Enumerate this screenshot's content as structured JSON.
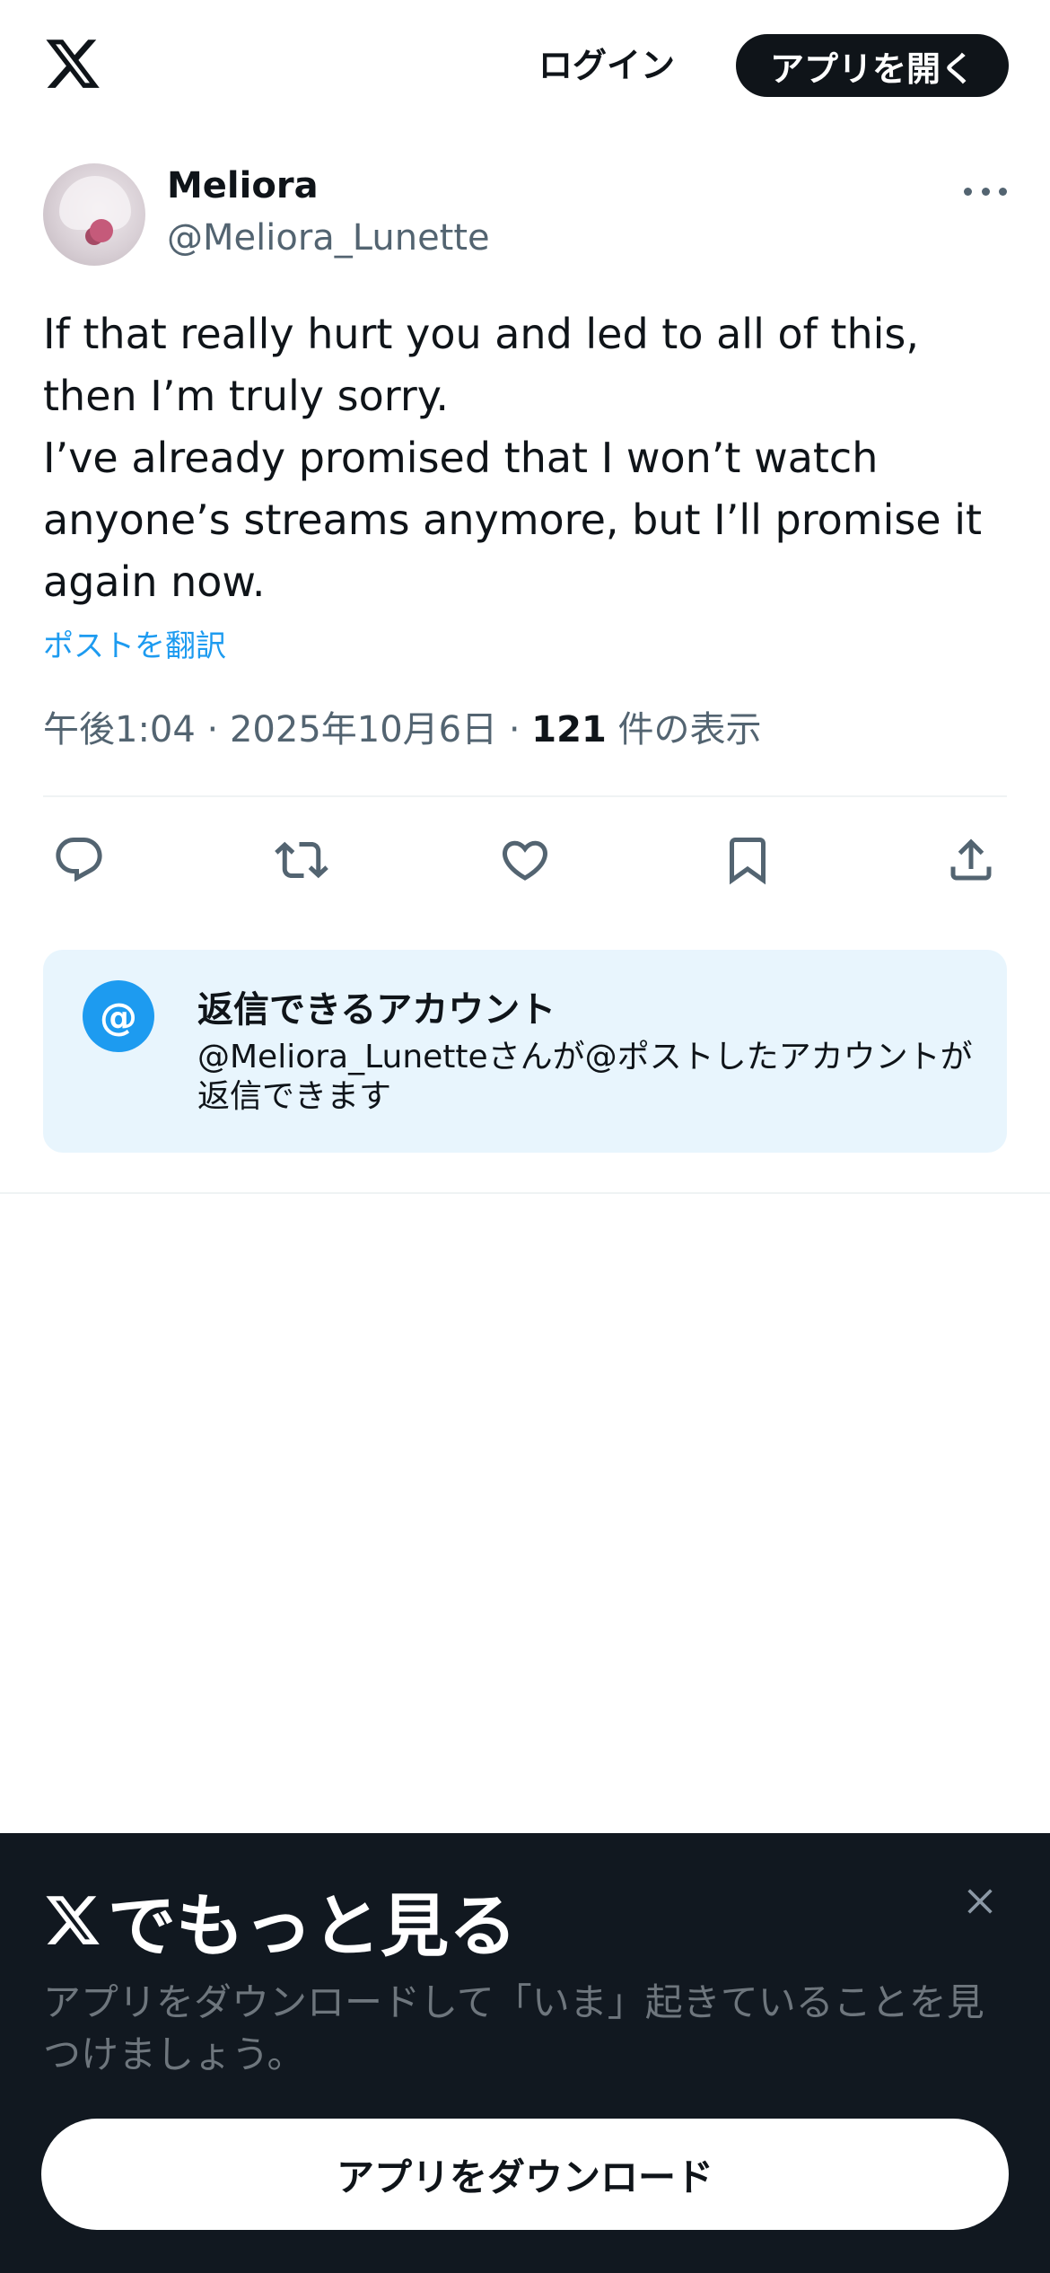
{
  "header": {
    "login_label": "ログイン",
    "open_app_label": "アプリを開く"
  },
  "author": {
    "name": "Meliora",
    "handle": "@Meliora_Lunette"
  },
  "tweet": {
    "text_lines": [
      "If that really hurt you and led to all of this, then I’m truly sorry.",
      "I’ve already promised that I won’t watch anyone’s streams anymore, but I’ll promise it again now."
    ],
    "translate_label": "ポストを翻訳",
    "time": "午後1:04",
    "date": "2025年10月6日",
    "separator": "·",
    "view_count": "121",
    "view_label": "件の表示"
  },
  "actions": {
    "icons": [
      "reply-icon",
      "retweet-icon",
      "like-icon",
      "bookmark-icon",
      "share-icon"
    ]
  },
  "reply_restriction": {
    "icon_glyph": "@",
    "title": "返信できるアカウント",
    "description": "@Meliora_Lunetteさんが@ポストしたアカウントが返信できます"
  },
  "banner": {
    "title": "でもっと見る",
    "description": "アプリをダウンロードして「いま」起きていることを見つけましょう。",
    "download_label": "アプリをダウンロード"
  },
  "colors": {
    "text": "#0f1419",
    "secondary": "#536471",
    "accent": "#1d9bf0",
    "reply_box_bg": "#e8f5fd",
    "banner_bg": "#111820"
  }
}
